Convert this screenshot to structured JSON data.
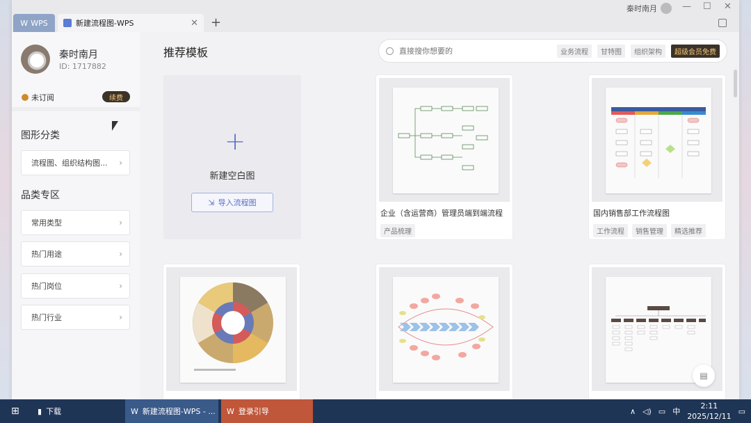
{
  "window": {
    "tab_app": "WPS",
    "tab_doc": "新建流程图-WPS",
    "tab_add": "+",
    "username_top": "秦时南月"
  },
  "sidebar": {
    "username": "秦时南月",
    "user_id": "ID: 1717882",
    "subscription": "未订阅",
    "renew": "续费",
    "section1": "图形分类",
    "section1_item": "流程图、组织结构图...",
    "section2": "品类专区",
    "section2_items": [
      "常用类型",
      "热门用途",
      "热门岗位",
      "热门行业"
    ]
  },
  "main": {
    "title": "推荐模板",
    "search_placeholder": "直接搜你想要的",
    "chips": [
      "业务流程",
      "甘特图",
      "组织架构",
      "超级会员免费"
    ],
    "blank_label": "新建空白图",
    "import_label": "导入流程图",
    "cards": [
      {
        "title": "企业（含运营商）管理员端到端流程",
        "tags": [
          "产品梳理"
        ]
      },
      {
        "title": "国内销售部工作流程图",
        "tags": [
          "工作流程",
          "销售管理",
          "精选推荐"
        ]
      }
    ]
  },
  "taskbar": {
    "items": [
      "下载",
      "新建流程图-WPS - ...",
      "登录引导"
    ],
    "ime": "中",
    "time": "2:11",
    "date": "2025/12/11"
  }
}
